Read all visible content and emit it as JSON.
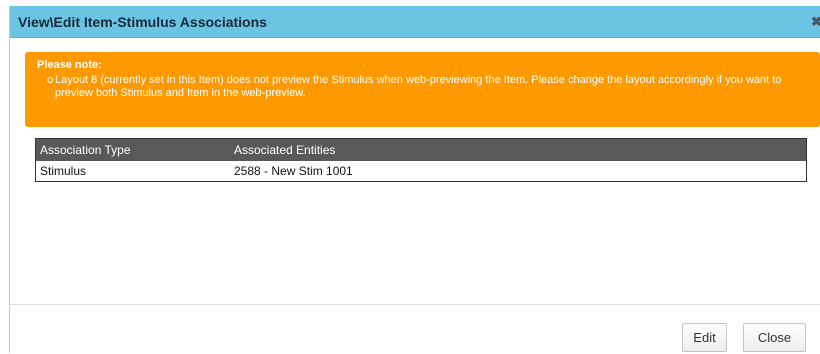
{
  "dialog": {
    "title": "View\\Edit Item-Stimulus Associations",
    "close_glyph": "✖"
  },
  "note": {
    "heading": "Please note:",
    "bullet_glyph": "o",
    "lines": [
      "Layout 8 (currently set in this Item) does not preview the Stimulus when web-previewing the Item. Please change the layout accordingly if you want to preview both Stimulus and Item in the web-preview."
    ]
  },
  "table": {
    "headers": [
      "Association Type",
      "Associated Entities"
    ],
    "rows": [
      [
        "Stimulus",
        "2588 - New Stim 1001"
      ]
    ]
  },
  "buttons": {
    "edit": "Edit",
    "close": "Close"
  },
  "colors": {
    "titlebar": "#6cc4e4",
    "note_bg": "#ff9900",
    "table_header": "#595959"
  },
  "icons": {
    "close": "close-icon"
  }
}
